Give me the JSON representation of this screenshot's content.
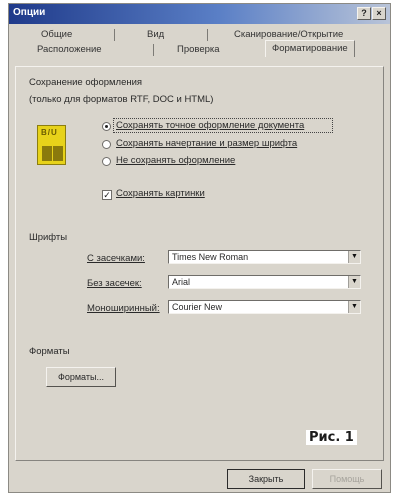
{
  "window": {
    "title": "Опции",
    "help_button": "?",
    "close_button": "×"
  },
  "tabs": {
    "row1": [
      "Общие",
      "Вид",
      "Сканирование/Открытие"
    ],
    "row2": [
      "Расположение",
      "Проверка",
      "Форматирование"
    ],
    "active": "Форматирование"
  },
  "formatting": {
    "group_label": "Сохранение оформления",
    "note": "(только для форматов RTF, DOC и HTML)",
    "options": [
      {
        "label": "Сохранять точное оформление документа",
        "selected": true
      },
      {
        "label": "Сохранять начертание и размер шрифта",
        "selected": false
      },
      {
        "label": "Не сохранять оформление",
        "selected": false
      }
    ],
    "preview_glyph": "B/U",
    "keep_images": {
      "label": "Сохранять картинки",
      "checked": true
    }
  },
  "fonts": {
    "group_label": "Шрифты",
    "rows": [
      {
        "label": "С засечками:",
        "value": "Times New Roman"
      },
      {
        "label": "Без засечек:",
        "value": "Arial"
      },
      {
        "label": "Моноширинный:",
        "value": "Courier New"
      }
    ]
  },
  "formats": {
    "group_label": "Форматы",
    "button": "Форматы..."
  },
  "footer": {
    "close_button": "Закрыть",
    "disabled_button": "Помощь"
  },
  "caption": "Рис. 1"
}
